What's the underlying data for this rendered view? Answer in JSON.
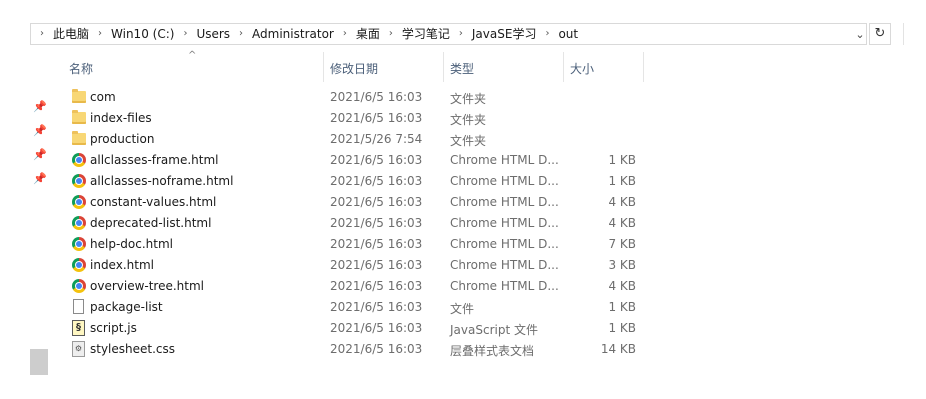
{
  "address": {
    "crumbs": [
      "此电脑",
      "Win10 (C:)",
      "Users",
      "Administrator",
      "桌面",
      "学习笔记",
      "JavaSE学习",
      "out"
    ],
    "separator": "›",
    "dropdown_icon": "chevron-down-icon",
    "refresh_icon": "refresh-icon",
    "refresh_glyph": "↻",
    "dropdown_glyph": "⌄"
  },
  "nav": {
    "pins": [
      "pin-icon",
      "pin-icon",
      "pin-icon",
      "pin-icon"
    ],
    "pin_glyph": "📌"
  },
  "columns": {
    "name": "名称",
    "date": "修改日期",
    "type": "类型",
    "size": "大小",
    "sort_glyph": "^"
  },
  "files": [
    {
      "icon": "folder",
      "name": "com",
      "date": "2021/6/5 16:03",
      "type": "文件夹",
      "size": ""
    },
    {
      "icon": "folder",
      "name": "index-files",
      "date": "2021/6/5 16:03",
      "type": "文件夹",
      "size": ""
    },
    {
      "icon": "folder",
      "name": "production",
      "date": "2021/5/26 7:54",
      "type": "文件夹",
      "size": ""
    },
    {
      "icon": "chrome",
      "name": "allclasses-frame.html",
      "date": "2021/6/5 16:03",
      "type": "Chrome HTML D...",
      "size": "1 KB"
    },
    {
      "icon": "chrome",
      "name": "allclasses-noframe.html",
      "date": "2021/6/5 16:03",
      "type": "Chrome HTML D...",
      "size": "1 KB"
    },
    {
      "icon": "chrome",
      "name": "constant-values.html",
      "date": "2021/6/5 16:03",
      "type": "Chrome HTML D...",
      "size": "4 KB"
    },
    {
      "icon": "chrome",
      "name": "deprecated-list.html",
      "date": "2021/6/5 16:03",
      "type": "Chrome HTML D...",
      "size": "4 KB"
    },
    {
      "icon": "chrome",
      "name": "help-doc.html",
      "date": "2021/6/5 16:03",
      "type": "Chrome HTML D...",
      "size": "7 KB"
    },
    {
      "icon": "chrome",
      "name": "index.html",
      "date": "2021/6/5 16:03",
      "type": "Chrome HTML D...",
      "size": "3 KB"
    },
    {
      "icon": "chrome",
      "name": "overview-tree.html",
      "date": "2021/6/5 16:03",
      "type": "Chrome HTML D...",
      "size": "4 KB"
    },
    {
      "icon": "file",
      "name": "package-list",
      "date": "2021/6/5 16:03",
      "type": "文件",
      "size": "1 KB"
    },
    {
      "icon": "js",
      "name": "script.js",
      "date": "2021/6/5 16:03",
      "type": "JavaScript 文件",
      "size": "1 KB"
    },
    {
      "icon": "css",
      "name": "stylesheet.css",
      "date": "2021/6/5 16:03",
      "type": "层叠样式表文档",
      "size": "14 KB"
    }
  ]
}
